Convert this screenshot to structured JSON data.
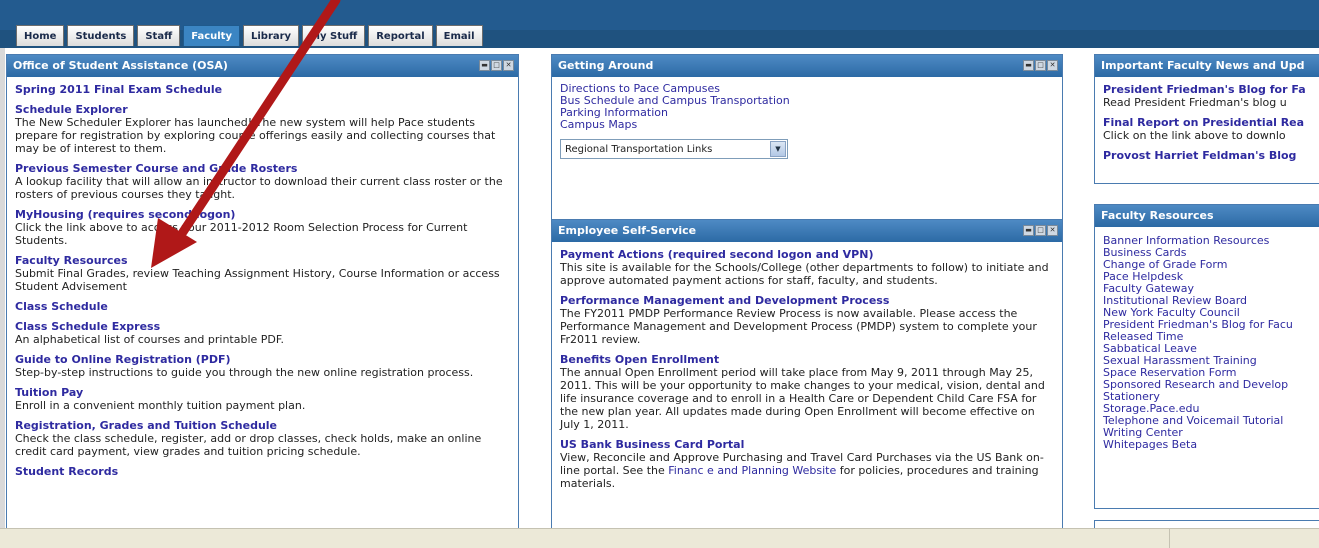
{
  "nav": {
    "tabs": [
      {
        "label": "Home",
        "active": false
      },
      {
        "label": "Students",
        "active": false
      },
      {
        "label": "Staff",
        "active": false
      },
      {
        "label": "Faculty",
        "active": true
      },
      {
        "label": "Library",
        "active": false
      },
      {
        "label": "My Stuff",
        "active": false
      },
      {
        "label": "Reportal",
        "active": false
      },
      {
        "label": "Email",
        "active": false
      }
    ]
  },
  "osa": {
    "title": "Office of Student Assistance (OSA)",
    "items": [
      {
        "title": "Spring 2011 Final Exam Schedule",
        "desc": ""
      },
      {
        "title": "Schedule Explorer",
        "desc": "The New Scheduler Explorer has launched!  The new system will help Pace students prepare for registration by exploring course offerings easily and collecting courses that may be of interest to them."
      },
      {
        "title": "Previous Semester Course and Grade Rosters",
        "desc": "A lookup facility that will allow an instructor to download their current class roster or the rosters of previous courses they taught."
      },
      {
        "title": "MyHousing (requires second logon)",
        "desc": "Click the link above to access your 2011-2012 Room Selection Process for Current Students."
      },
      {
        "title": "Faculty Resources",
        "desc": "Submit Final Grades, review Teaching Assignment History, Course Information or access Student Advisement"
      },
      {
        "title": "Class Schedule",
        "desc": ""
      },
      {
        "title": "Class Schedule Express",
        "desc": "An alphabetical list of courses and printable PDF."
      },
      {
        "title": "Guide to Online Registration (PDF)",
        "desc": "Step-by-step instructions to guide you through the new online registration process."
      },
      {
        "title": "Tuition Pay",
        "desc": "Enroll in a convenient monthly tuition payment plan."
      },
      {
        "title": "Registration, Grades and Tuition Schedule",
        "desc": "Check the class schedule, register, add or drop classes, check holds, make an online credit card payment, view grades and tuition pricing schedule."
      },
      {
        "title": "Student Records",
        "desc": ""
      }
    ]
  },
  "getting_around": {
    "title": "Getting Around",
    "links": [
      "Directions to Pace Campuses",
      "Bus Schedule and Campus Transportation",
      "Parking Information",
      "Campus Maps"
    ],
    "select_value": "Regional Transportation Links"
  },
  "ess": {
    "title": "Employee Self-Service",
    "items": [
      {
        "title": "Payment Actions (required second logon and VPN)",
        "desc": "This site is available for the Schools/College (other departments to follow) to initiate and approve automated payment actions for staff, faculty, and students."
      },
      {
        "title": "Performance Management and Development Process",
        "desc": "The FY2011 PMDP Performance Review Process is now available. Please access the Performance Management and Development Process (PMDP) system to complete your Fr2011 review."
      },
      {
        "title": "Benefits Open Enrollment",
        "desc": "The annual Open Enrollment period will take place from May 9, 2011 through May 25, 2011. This will be your opportunity to make changes to your medical, vision, dental and life insurance coverage and to enroll in a Health Care or Dependent Child Care FSA for the new plan year. All updates made during Open Enrollment will become effective on July 1, 2011."
      },
      {
        "title": "US Bank Business Card Portal",
        "desc_prefix": "View, Reconcile and Approve Purchasing and Travel Card Purchases via the US Bank on-line portal.  See the ",
        "desc_link": "Financ e and Planning Website",
        "desc_suffix": " for policies, procedures and training materials."
      }
    ]
  },
  "news": {
    "title": "Important Faculty News and Upd",
    "items": [
      {
        "title": "President Friedman's Blog for Fa",
        "desc": "Read President Friedman's blog u"
      },
      {
        "title": "Final Report on Presidential Rea",
        "desc": "Click on the link above to downlo"
      },
      {
        "title": "Provost Harriet Feldman's Blog",
        "desc": ""
      }
    ]
  },
  "faculty_resources": {
    "title": "Faculty Resources",
    "links": [
      "Banner Information Resources",
      "Business Cards",
      "Change of Grade Form",
      "Pace Helpdesk",
      "Faculty Gateway",
      "Institutional Review Board",
      "New York Faculty Council",
      "President Friedman's Blog for Facu",
      "Released Time",
      "Sabbatical Leave",
      "Sexual Harassment Training",
      "Space Reservation Form",
      "Sponsored Research and Develop",
      "Stationery",
      "Storage.Pace.edu",
      "Telephone and Voicemail Tutorial",
      "Writing Center",
      "Whitepages Beta"
    ]
  },
  "annotation": {
    "arrow_color": "#b01818"
  }
}
